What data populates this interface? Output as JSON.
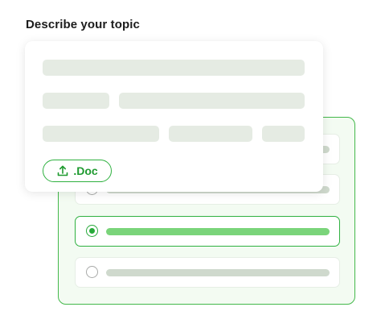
{
  "heading": "Describe your topic",
  "description_card": {
    "upload_button": {
      "label": ".Doc",
      "icon": "upload-icon"
    }
  },
  "options": [
    {
      "selected": false
    },
    {
      "selected": false
    },
    {
      "selected": true
    },
    {
      "selected": false
    }
  ],
  "colors": {
    "accent": "#2fb140",
    "panel_bg": "#f3fbf2",
    "placeholder": "#e5ebe3",
    "selected_bar": "#7ad47a"
  }
}
